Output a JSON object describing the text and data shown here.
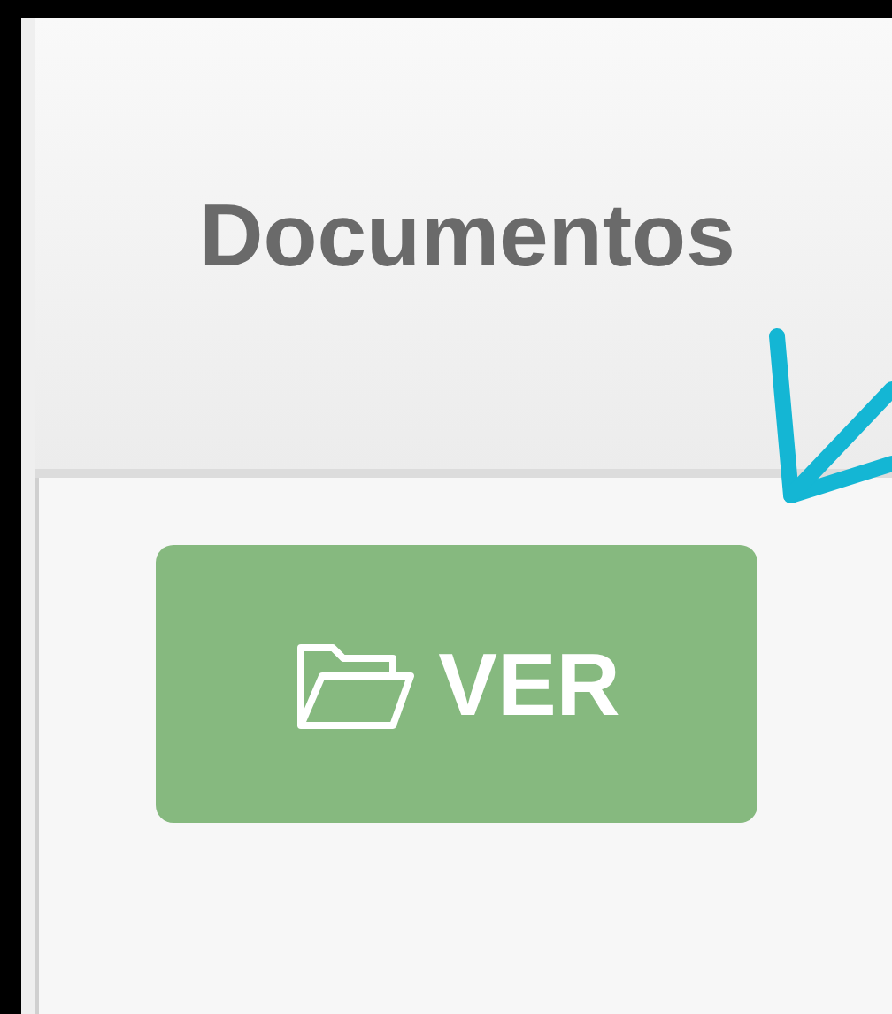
{
  "table": {
    "columns": [
      {
        "label": "Documentos"
      }
    ],
    "rows": [
      {
        "button": {
          "label": "VER"
        }
      }
    ]
  }
}
